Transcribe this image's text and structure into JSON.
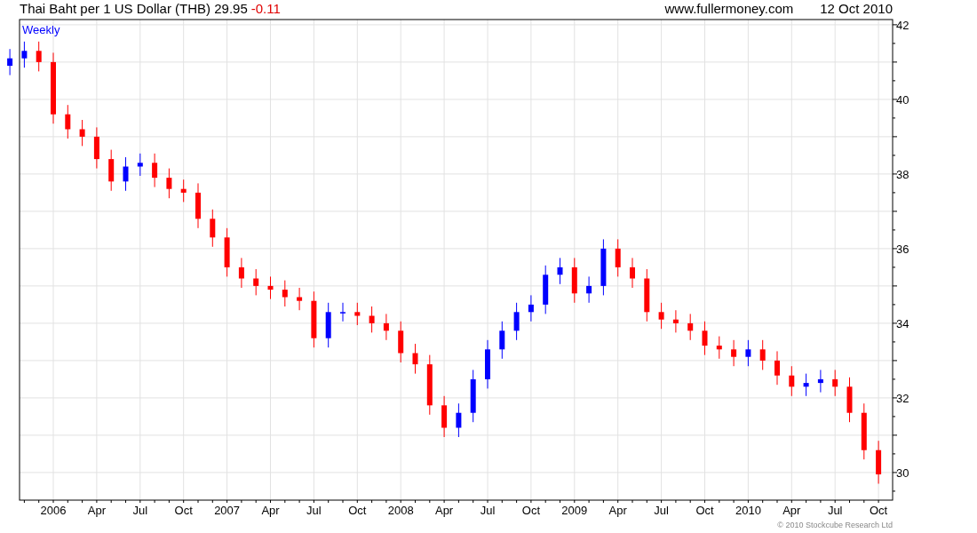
{
  "header": {
    "title": "Thai Baht per 1 US Dollar (THB) 29.95",
    "change": "-0.11",
    "site": "www.fullermoney.com",
    "date": "12 Oct 2010"
  },
  "chart": {
    "period": "Weekly",
    "chart_data": {
      "type": "candlestick",
      "grid": true,
      "ylim": [
        29.26,
        42.14
      ],
      "yticks": [
        30,
        32,
        34,
        36,
        38,
        40,
        42
      ],
      "categories": [
        null,
        null,
        null,
        "2006",
        null,
        null,
        "Apr",
        null,
        null,
        "Jul",
        null,
        null,
        "Oct",
        null,
        null,
        "2007",
        null,
        null,
        "Apr",
        null,
        null,
        "Jul",
        null,
        null,
        "Oct",
        null,
        null,
        "2008",
        null,
        null,
        "Apr",
        null,
        null,
        "Jul",
        null,
        null,
        "Oct",
        null,
        null,
        "2009",
        null,
        null,
        "Apr",
        null,
        null,
        "Jul",
        null,
        null,
        "Oct",
        null,
        null,
        "2010",
        null,
        null,
        "Apr",
        null,
        null,
        "Jul",
        null,
        null,
        "Oct"
      ],
      "ohlc": [
        [
          40.9,
          41.35,
          40.65,
          41.1
        ],
        [
          41.1,
          41.55,
          40.85,
          41.3
        ],
        [
          41.3,
          41.55,
          40.75,
          41.0
        ],
        [
          41.0,
          41.25,
          39.35,
          39.6
        ],
        [
          39.6,
          39.85,
          38.95,
          39.2
        ],
        [
          39.2,
          39.45,
          38.75,
          39.0
        ],
        [
          39.0,
          39.25,
          38.15,
          38.4
        ],
        [
          38.4,
          38.65,
          37.55,
          37.8
        ],
        [
          37.8,
          38.45,
          37.55,
          38.2
        ],
        [
          38.2,
          38.55,
          37.95,
          38.3
        ],
        [
          38.3,
          38.55,
          37.65,
          37.9
        ],
        [
          37.9,
          38.15,
          37.35,
          37.6
        ],
        [
          37.6,
          37.85,
          37.25,
          37.5
        ],
        [
          37.5,
          37.75,
          36.55,
          36.8
        ],
        [
          36.8,
          37.05,
          36.05,
          36.3
        ],
        [
          36.3,
          36.55,
          35.25,
          35.5
        ],
        [
          35.5,
          35.75,
          34.95,
          35.2
        ],
        [
          35.2,
          35.45,
          34.75,
          35.0
        ],
        [
          35.0,
          35.25,
          34.65,
          34.9
        ],
        [
          34.9,
          35.15,
          34.45,
          34.7
        ],
        [
          34.7,
          34.95,
          34.35,
          34.6
        ],
        [
          34.6,
          34.85,
          33.35,
          33.6
        ],
        [
          33.6,
          34.55,
          33.35,
          34.3
        ],
        [
          34.3,
          34.55,
          34.05,
          34.3
        ],
        [
          34.3,
          34.55,
          33.95,
          34.2
        ],
        [
          34.2,
          34.45,
          33.75,
          34.0
        ],
        [
          34.0,
          34.25,
          33.55,
          33.8
        ],
        [
          33.8,
          34.05,
          32.95,
          33.2
        ],
        [
          33.2,
          33.45,
          32.65,
          32.9
        ],
        [
          32.9,
          33.15,
          31.55,
          31.8
        ],
        [
          31.8,
          32.05,
          30.95,
          31.2
        ],
        [
          31.2,
          31.85,
          30.95,
          31.6
        ],
        [
          31.6,
          32.75,
          31.35,
          32.5
        ],
        [
          32.5,
          33.55,
          32.25,
          33.3
        ],
        [
          33.3,
          34.05,
          33.05,
          33.8
        ],
        [
          33.8,
          34.55,
          33.55,
          34.3
        ],
        [
          34.3,
          34.75,
          34.05,
          34.5
        ],
        [
          34.5,
          35.55,
          34.25,
          35.3
        ],
        [
          35.3,
          35.75,
          35.05,
          35.5
        ],
        [
          35.5,
          35.75,
          34.55,
          34.8
        ],
        [
          34.8,
          35.25,
          34.55,
          35.0
        ],
        [
          35.0,
          36.25,
          34.75,
          36.0
        ],
        [
          36.0,
          36.25,
          35.25,
          35.5
        ],
        [
          35.5,
          35.75,
          34.95,
          35.2
        ],
        [
          35.2,
          35.45,
          34.05,
          34.3
        ],
        [
          34.3,
          34.55,
          33.85,
          34.1
        ],
        [
          34.1,
          34.35,
          33.75,
          34.0
        ],
        [
          34.0,
          34.25,
          33.55,
          33.8
        ],
        [
          33.8,
          34.05,
          33.15,
          33.4
        ],
        [
          33.4,
          33.65,
          33.05,
          33.3
        ],
        [
          33.3,
          33.55,
          32.85,
          33.1
        ],
        [
          33.1,
          33.55,
          32.85,
          33.3
        ],
        [
          33.3,
          33.55,
          32.75,
          33.0
        ],
        [
          33.0,
          33.25,
          32.35,
          32.6
        ],
        [
          32.6,
          32.85,
          32.05,
          32.3
        ],
        [
          32.3,
          32.65,
          32.05,
          32.4
        ],
        [
          32.4,
          32.75,
          32.15,
          32.5
        ],
        [
          32.5,
          32.75,
          32.05,
          32.3
        ],
        [
          32.3,
          32.55,
          31.35,
          31.6
        ],
        [
          31.6,
          31.85,
          30.35,
          30.6
        ],
        [
          30.6,
          30.85,
          29.7,
          29.95
        ]
      ]
    }
  },
  "footer": {
    "copyright": "© 2010 Stockcube Research Ltd"
  }
}
